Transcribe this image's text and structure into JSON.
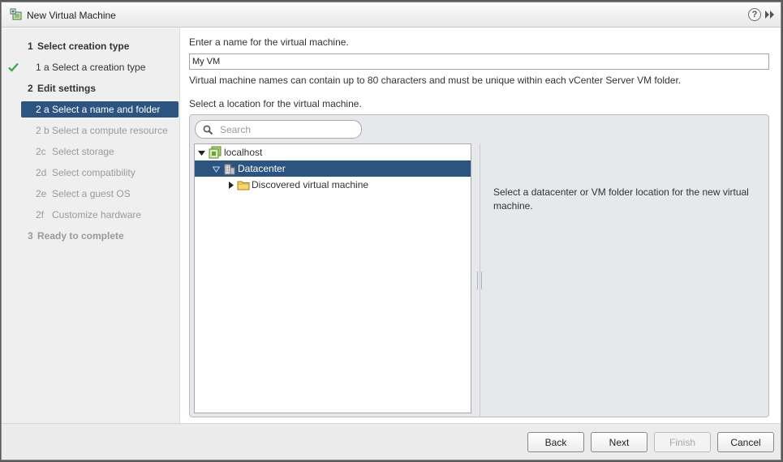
{
  "window": {
    "title": "New Virtual Machine",
    "help_label": "?"
  },
  "sidebar": {
    "steps": [
      {
        "num": "1",
        "label": "Select creation type"
      },
      {
        "num": "1 a",
        "label": "Select a creation type",
        "completed": true
      },
      {
        "num": "2",
        "label": "Edit settings"
      },
      {
        "num": "2 a",
        "label": "Select a name and folder",
        "active": true
      },
      {
        "num": "2 b",
        "label": "Select a compute resource"
      },
      {
        "num": "2c",
        "label": "Select storage"
      },
      {
        "num": "2d",
        "label": "Select compatibility"
      },
      {
        "num": "2e",
        "label": "Select a guest OS"
      },
      {
        "num": "2f",
        "label": "Customize hardware"
      },
      {
        "num": "3",
        "label": "Ready to complete"
      }
    ]
  },
  "main": {
    "name_prompt": "Enter a name for the virtual machine.",
    "name_value": "My VM",
    "name_hint": "Virtual machine names can contain up to 80 characters and must be unique within each vCenter Server VM folder.",
    "location_prompt": "Select a location for the virtual machine.",
    "search_placeholder": "Search",
    "tree": [
      {
        "label": "localhost",
        "expanded": true,
        "icon": "vcenter-icon"
      },
      {
        "label": "Datacenter",
        "expanded": true,
        "selected": true,
        "icon": "datacenter-icon"
      },
      {
        "label": "Discovered virtual machine",
        "expanded": false,
        "icon": "folder-icon"
      }
    ],
    "info_text": "Select a datacenter or VM folder location for the new virtual machine."
  },
  "footer": {
    "back_label": "Back",
    "next_label": "Next",
    "finish_label": "Finish",
    "cancel_label": "Cancel"
  },
  "colors": {
    "selection": "#2b5481",
    "check": "#3aa83a",
    "panel": "#e6e8ec"
  }
}
